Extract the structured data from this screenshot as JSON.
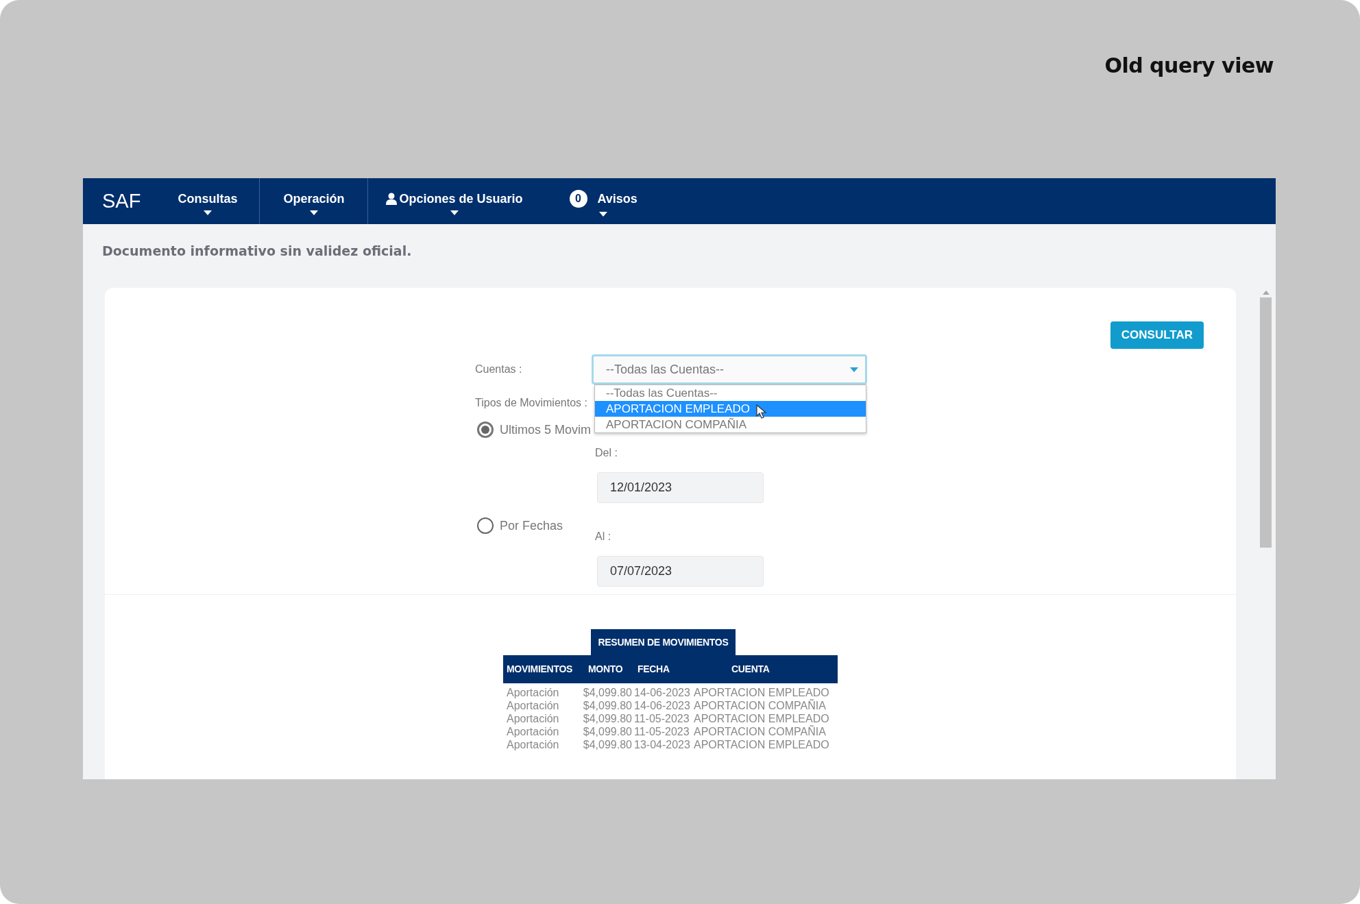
{
  "page_title": "Old query view",
  "navbar": {
    "brand": "SAF",
    "items": [
      {
        "label": "Consultas",
        "kind": "plain"
      },
      {
        "label": "Operación",
        "kind": "plain"
      },
      {
        "label": "Opciones de Usuario",
        "kind": "user"
      },
      {
        "label": "Avisos",
        "kind": "badge",
        "badge": "0"
      }
    ]
  },
  "notice": "Documento informativo sin validez oficial.",
  "consult_button": "CONSULTAR",
  "form": {
    "cuentas_label": "Cuentas :",
    "cuentas_select": {
      "value": "--Todas las Cuentas--",
      "expanded": true,
      "options": [
        {
          "label": "--Todas las Cuentas--",
          "highlighted": false
        },
        {
          "label": "APORTACION EMPLEADO",
          "highlighted": true
        },
        {
          "label": "APORTACION COMPAÑIA",
          "highlighted": false
        }
      ]
    },
    "tipos_label": "Tipos de Movimientos :",
    "choices": [
      {
        "label": "Ultimos 5 Movim",
        "selected": true
      },
      {
        "label": "Por Fechas",
        "selected": false
      }
    ],
    "del_label": "Del :",
    "del_value": "12/01/2023",
    "al_label": "Al :",
    "al_value": "07/07/2023"
  },
  "summary": {
    "title": "RESUMEN DE MOVIMIENTOS",
    "columns": [
      "MOVIMIENTOS",
      "MONTO",
      "FECHA",
      "CUENTA"
    ],
    "rows": [
      [
        "Aportación",
        "$4,099.80",
        "14-06-2023",
        "APORTACION EMPLEADO"
      ],
      [
        "Aportación",
        "$4,099.80",
        "14-06-2023",
        "APORTACION COMPAÑIA"
      ],
      [
        "Aportación",
        "$4,099.80",
        "11-05-2023",
        "APORTACION EMPLEADO"
      ],
      [
        "Aportación",
        "$4,099.80",
        "11-05-2023",
        "APORTACION COMPAÑIA"
      ],
      [
        "Aportación",
        "$4,099.80",
        "13-04-2023",
        "APORTACION EMPLEADO"
      ]
    ]
  }
}
